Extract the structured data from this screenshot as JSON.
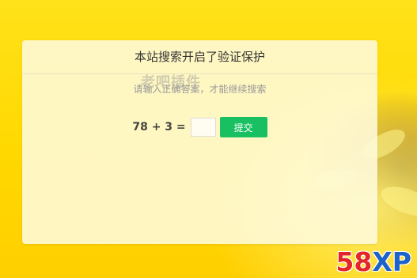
{
  "dialog": {
    "title": "本站搜索开启了验证保护",
    "subtitle": "请输入正确答案，才能继续搜索",
    "watermark": "老吧插件"
  },
  "captcha": {
    "equation": "78 + 3 =",
    "answer_value": "",
    "submit_label": "提交"
  },
  "brand": {
    "number": "58",
    "letters": "XP"
  },
  "colors": {
    "background": "#ffd800",
    "card": "#fffadc",
    "submit": "#18c062",
    "brand_number": "#e3262a",
    "brand_letters": "#1d63c9"
  }
}
